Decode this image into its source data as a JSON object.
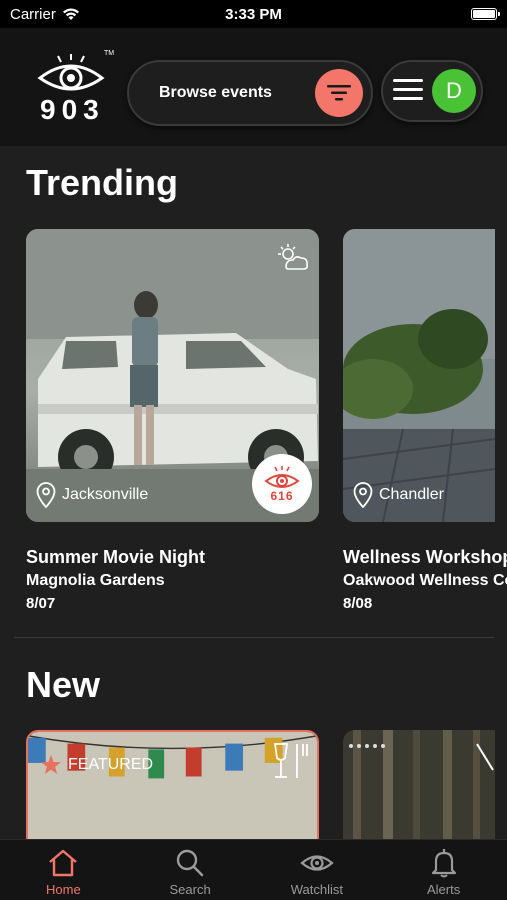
{
  "status_bar": {
    "carrier": "Carrier",
    "time": "3:33 PM"
  },
  "header": {
    "logo_text": "903",
    "logo_tm": "TM",
    "browse_label": "Browse events",
    "avatar_initial": "D"
  },
  "trending": {
    "title": "Trending",
    "cards": [
      {
        "location": "Jacksonville",
        "title": "Summer Movie Night",
        "venue": "Magnolia Gardens",
        "date": "8/07",
        "views": "616"
      },
      {
        "location": "Chandler",
        "title": "Wellness Workshop",
        "venue": "Oakwood Wellness Center",
        "date": "8/08"
      }
    ]
  },
  "new": {
    "title": "New",
    "cards": [
      {
        "featured_label": "FEATURED"
      },
      {}
    ]
  },
  "tabs": [
    {
      "label": "Home",
      "icon": "home-icon",
      "active": true
    },
    {
      "label": "Search",
      "icon": "search-icon",
      "active": false
    },
    {
      "label": "Watchlist",
      "icon": "eye-icon",
      "active": false
    },
    {
      "label": "Alerts",
      "icon": "bell-icon",
      "active": false
    }
  ],
  "colors": {
    "accent": "#f4756a",
    "avatar": "#49c236",
    "background": "#1f1f1f",
    "header": "#141414"
  }
}
